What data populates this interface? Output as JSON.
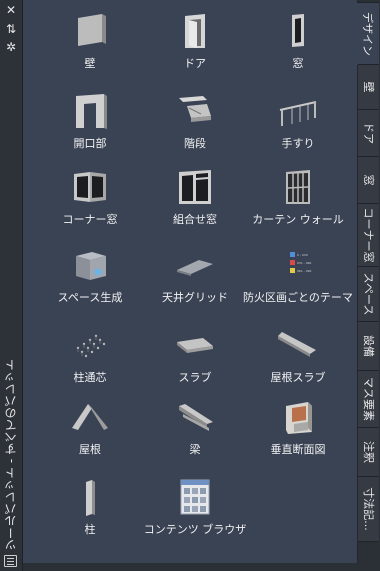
{
  "palette_title": "ツールパレット - すべてのパレット",
  "tools": [
    {
      "label": "壁",
      "icon": "wall-icon"
    },
    {
      "label": "ドア",
      "icon": "door-icon"
    },
    {
      "label": "窓",
      "icon": "window-icon"
    },
    {
      "label": "開口部",
      "icon": "opening-icon"
    },
    {
      "label": "階段",
      "icon": "stair-icon"
    },
    {
      "label": "手すり",
      "icon": "railing-icon"
    },
    {
      "label": "コーナー窓",
      "icon": "corner-window-icon"
    },
    {
      "label": "組合せ窓",
      "icon": "assembly-window-icon"
    },
    {
      "label": "カーテン ウォール",
      "icon": "curtain-wall-icon"
    },
    {
      "label": "スペース生成",
      "icon": "space-generate-icon"
    },
    {
      "label": "天井グリッド",
      "icon": "ceiling-grid-icon"
    },
    {
      "label": "防火区画ごとのテーマ",
      "icon": "fire-rating-theme-icon"
    },
    {
      "label": "柱通芯",
      "icon": "column-grid-icon"
    },
    {
      "label": "スラブ",
      "icon": "slab-icon"
    },
    {
      "label": "屋根スラブ",
      "icon": "roof-slab-icon"
    },
    {
      "label": "屋根",
      "icon": "roof-icon"
    },
    {
      "label": "梁",
      "icon": "beam-icon"
    },
    {
      "label": "垂直断面図",
      "icon": "vertical-section-icon"
    },
    {
      "label": "柱",
      "icon": "column-icon"
    },
    {
      "label": "コンテンツ ブラウザ",
      "icon": "content-browser-icon"
    }
  ],
  "theme_legend": [
    "0 - 030",
    "031 - 060",
    "061 - 090"
  ],
  "tabs": [
    "デザイン",
    "壁",
    "ドア",
    "窓",
    "コーナー窓",
    "スペース",
    "設備",
    "マス要素",
    "注釈",
    "寸法記..."
  ],
  "active_tab": "デザイン",
  "colors": {
    "palette_bg": "#3a4354",
    "frame_bg": "#2b2f36",
    "text": "#f2f2f2"
  }
}
